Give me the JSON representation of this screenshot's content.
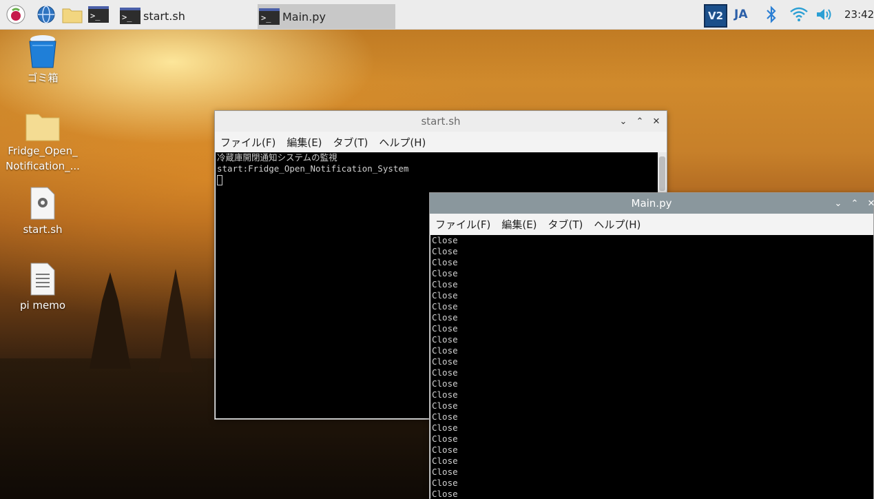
{
  "taskbar": {
    "tasks": [
      {
        "label": "start.sh"
      },
      {
        "label": "Main.py"
      }
    ],
    "tray": {
      "vnc_label": "V2",
      "language": "JA",
      "clock": "23:42"
    }
  },
  "desktop_icons": [
    {
      "label": "ゴミ箱",
      "icon": "trash-icon"
    },
    {
      "label": "Fridge_Open_Notification_...",
      "line1": "Fridge_Open_",
      "line2": "Notification_...",
      "icon": "folder-icon"
    },
    {
      "label": "start.sh",
      "icon": "script-file-icon"
    },
    {
      "label": "pi memo",
      "icon": "text-file-icon"
    }
  ],
  "windows": {
    "start": {
      "title": "start.sh",
      "menu": [
        "ファイル(F)",
        "編集(E)",
        "タブ(T)",
        "ヘルプ(H)"
      ],
      "lines": [
        "冷蔵庫開閉通知システムの監視",
        "start:Fridge_Open_Notification_System"
      ]
    },
    "main": {
      "title": "Main.py",
      "menu": [
        "ファイル(F)",
        "編集(E)",
        "タブ(T)",
        "ヘルプ(H)"
      ],
      "lines": [
        "Close",
        "Close",
        "Close",
        "Close",
        "Close",
        "Close",
        "Close",
        "Close",
        "Close",
        "Close",
        "Close",
        "Close",
        "Close",
        "Close",
        "Close",
        "Close",
        "Close",
        "Close",
        "Close",
        "Close",
        "Close",
        "Close",
        "Close",
        "Close"
      ]
    }
  },
  "colors": {
    "taskbar_bg": "#ececec",
    "active_titlebar": "#8a979d",
    "terminal_bg": "#000000",
    "terminal_fg": "#cfcfcf"
  }
}
